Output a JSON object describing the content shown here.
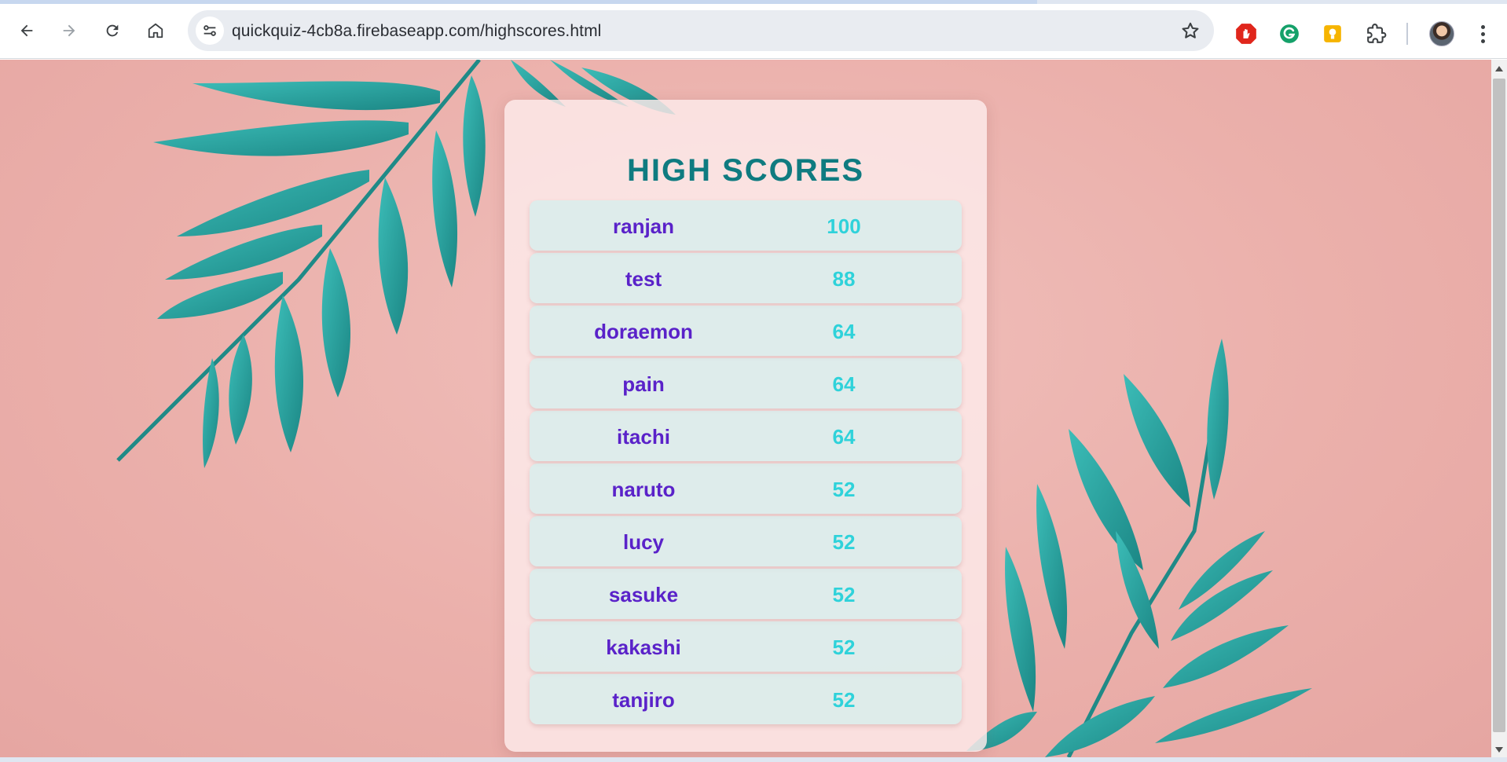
{
  "browser": {
    "url": "quickquiz-4cb8a.firebaseapp.com/highscores.html"
  },
  "page": {
    "title": "HIGH SCORES",
    "scores": [
      {
        "name": "ranjan",
        "score": "100"
      },
      {
        "name": "test",
        "score": "88"
      },
      {
        "name": "doraemon",
        "score": "64"
      },
      {
        "name": "pain",
        "score": "64"
      },
      {
        "name": "itachi",
        "score": "64"
      },
      {
        "name": "naruto",
        "score": "52"
      },
      {
        "name": "lucy",
        "score": "52"
      },
      {
        "name": "sasuke",
        "score": "52"
      },
      {
        "name": "kakashi",
        "score": "52"
      },
      {
        "name": "tanjiro",
        "score": "52"
      }
    ]
  },
  "colors": {
    "title": "#0f7b80",
    "player_name": "#5a22c9",
    "score_value": "#2fd2da",
    "background": "#ebb0ab",
    "leaf": "#2fa7a4"
  },
  "icons": [
    "back-icon",
    "forward-icon",
    "reload-icon",
    "home-icon",
    "site-settings-icon",
    "bookmark-star-icon",
    "adblock-icon",
    "grammarly-icon",
    "keep-notes-icon",
    "extensions-icon",
    "profile-avatar",
    "more-menu-icon"
  ]
}
